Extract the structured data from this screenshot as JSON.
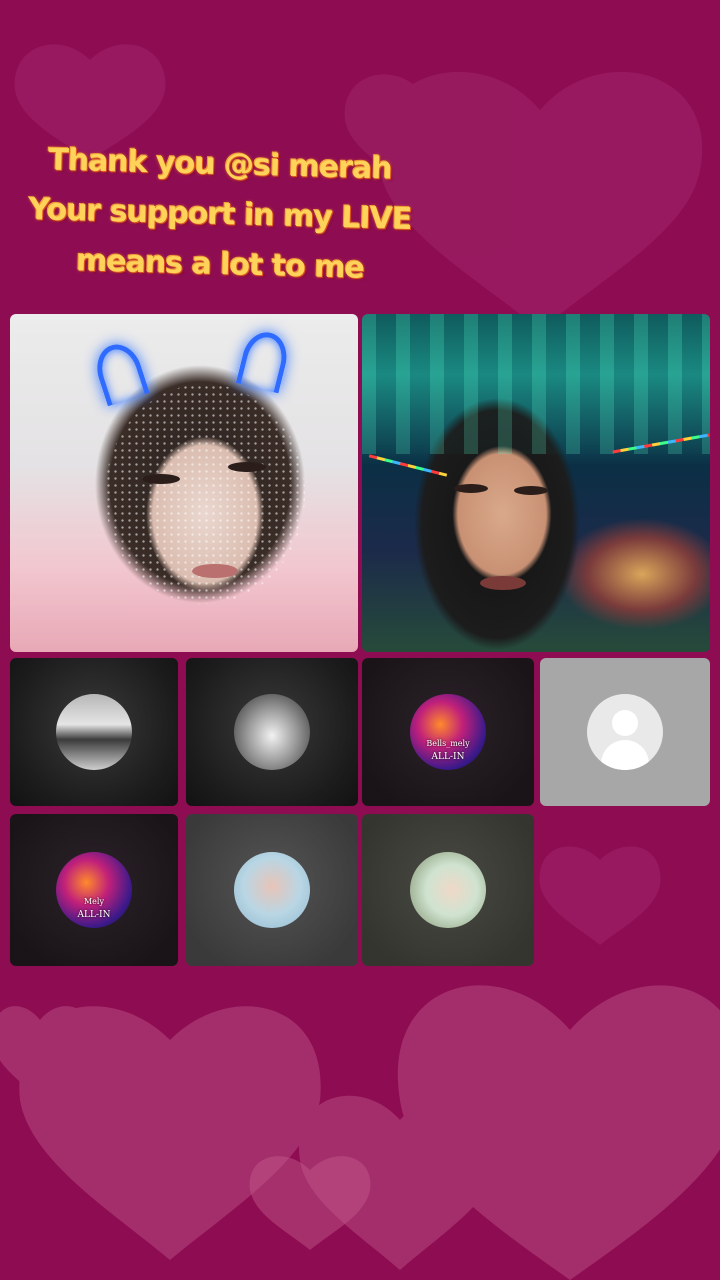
{
  "banner": {
    "line1": "Thank you @si merah",
    "line2": "Your support in my LIVE",
    "line3": "means a lot to me"
  },
  "guests": [
    {
      "name": "guest-camera-1",
      "type": "video"
    },
    {
      "name": "guest-camera-2",
      "type": "video"
    },
    {
      "avatar": "car-avatar"
    },
    {
      "avatar": "cat-avatar"
    },
    {
      "avatar": "phoenix-avatar",
      "caption_top": "Bells_mely",
      "caption": "ALL-IN"
    },
    {
      "avatar": "default-user-avatar"
    },
    {
      "avatar": "phoenix-girl-avatar",
      "caption_top": "Mely",
      "caption": "ALL-IN"
    },
    {
      "avatar": "selfie-avatar"
    },
    {
      "avatar": "photo-avatar"
    }
  ],
  "colors": {
    "background": "#8e0d52",
    "banner_text": "#ffd35a",
    "tile_dark": "#1c1c1c",
    "tile_empty": "#a7a7a7"
  }
}
